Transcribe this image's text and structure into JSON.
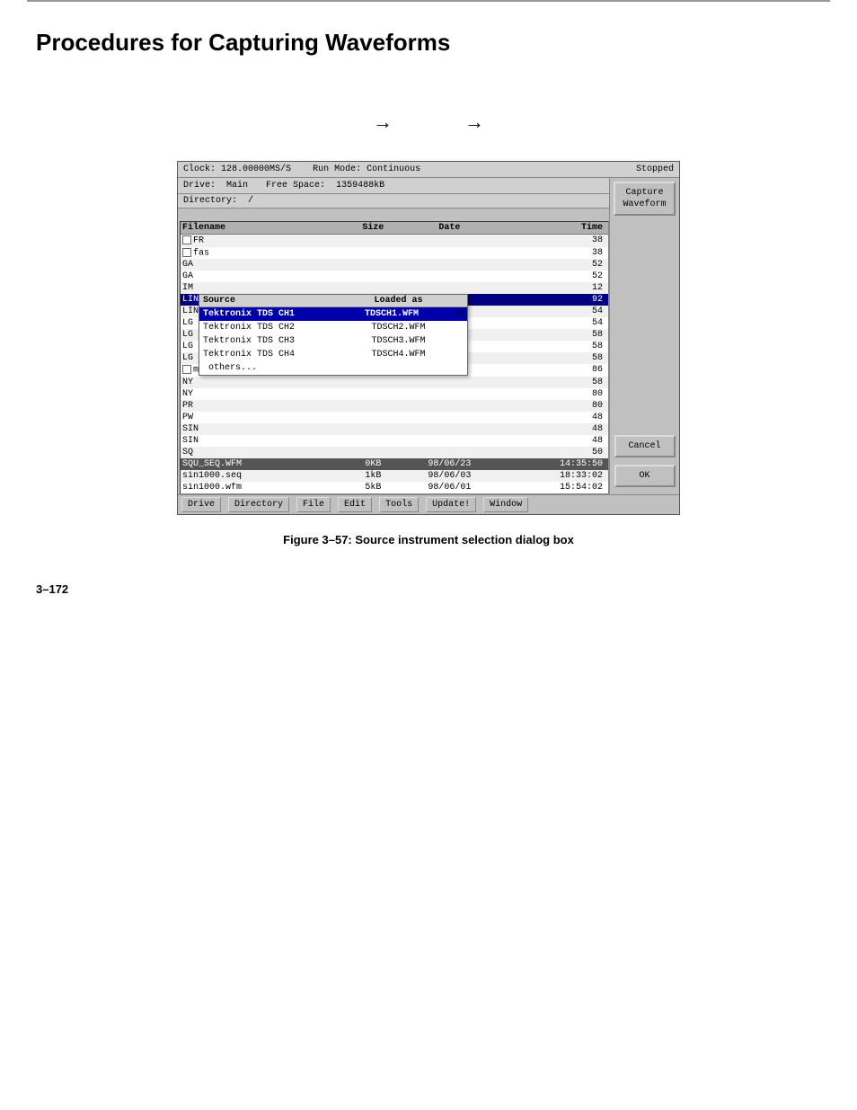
{
  "page": {
    "title": "Procedures for Capturing Waveforms",
    "page_number": "3–172"
  },
  "arrows": {
    "arrow1": "→",
    "arrow2": "→"
  },
  "dialog": {
    "topbar": {
      "clock_label": "Clock:",
      "clock_value": "128.00000MS/S",
      "runmode_label": "Run Mode:",
      "runmode_value": "Continuous",
      "status": "Stopped"
    },
    "header": {
      "drive_label": "Drive:",
      "drive_value": "Main",
      "freespace_label": "Free Space:",
      "freespace_value": "1359488kB"
    },
    "capture_btn": "Capture\nWaveform",
    "directory_label": "Directory:",
    "directory_value": "/",
    "table_headers": {
      "filename": "Filename",
      "size": "Size",
      "date": "Date",
      "time": "Time"
    },
    "files": [
      {
        "name": "FR",
        "checkbox": true,
        "size": "",
        "date": "",
        "time": "38"
      },
      {
        "name": "fas",
        "checkbox": true,
        "size": "",
        "date": "",
        "time": "38"
      },
      {
        "name": "GA",
        "checkbox": false,
        "size": "",
        "date": "",
        "time": "52"
      },
      {
        "name": "GA",
        "checkbox": false,
        "size": "",
        "date": "",
        "time": "52"
      },
      {
        "name": "IM",
        "checkbox": false,
        "size": "",
        "date": "",
        "time": "12"
      },
      {
        "name": "LIN",
        "checkbox": false,
        "size": "",
        "date": "",
        "time": "92",
        "selected": true
      },
      {
        "name": "LIN",
        "checkbox": false,
        "size": "",
        "date": "",
        "time": "54"
      },
      {
        "name": "LG",
        "checkbox": false,
        "size": "",
        "date": "",
        "time": "54"
      },
      {
        "name": "LG",
        "checkbox": false,
        "size": "",
        "date": "",
        "time": "58"
      },
      {
        "name": "LG",
        "checkbox": false,
        "size": "",
        "date": "",
        "time": "58"
      },
      {
        "name": "LG",
        "checkbox": false,
        "size": "",
        "date": "",
        "time": "58"
      },
      {
        "name": "me",
        "checkbox": true,
        "size": "",
        "date": "",
        "time": "86"
      },
      {
        "name": "NY",
        "checkbox": false,
        "size": "",
        "date": "",
        "time": "58"
      },
      {
        "name": "NY",
        "checkbox": false,
        "size": "",
        "date": "",
        "time": "80"
      },
      {
        "name": "PR",
        "checkbox": false,
        "size": "",
        "date": "",
        "time": "80"
      },
      {
        "name": "PW",
        "checkbox": false,
        "size": "",
        "date": "",
        "time": "48"
      },
      {
        "name": "SIN",
        "checkbox": false,
        "size": "",
        "date": "",
        "time": "48"
      },
      {
        "name": "SIN",
        "checkbox": false,
        "size": "",
        "date": "",
        "time": "48"
      },
      {
        "name": "SQ",
        "checkbox": false,
        "size": "",
        "date": "",
        "time": "50"
      },
      {
        "name": "SQU_SEQ.WFM",
        "checkbox": false,
        "size": "0KB",
        "date": "98/06/23",
        "time": "14:35:50",
        "bottom": true
      },
      {
        "name": "sin1000.seq",
        "checkbox": false,
        "size": "1kB",
        "date": "98/06/03",
        "time": "18:33:02"
      },
      {
        "name": "sin1000.wfm",
        "checkbox": false,
        "size": "5kB",
        "date": "98/06/01",
        "time": "15:54:02"
      }
    ],
    "source_dropdown": {
      "header_source": "Source",
      "header_loaded": "Loaded as",
      "items": [
        {
          "source": "Tektronix TDS CH1",
          "loaded": "TDSCH1.WFM",
          "bold": true
        },
        {
          "source": "Tektronix TDS CH2",
          "loaded": "TDSCH2.WFM",
          "bold": false
        },
        {
          "source": "Tektronix TDS CH3",
          "loaded": "TDSCH3.WFM",
          "bold": false
        },
        {
          "source": "Tektronix TDS CH4",
          "loaded": "TDSCH4.WFM",
          "bold": false
        },
        {
          "source": "others...",
          "loaded": "",
          "bold": false
        }
      ]
    },
    "side_buttons": {
      "cancel": "Cancel",
      "ok": "OK"
    },
    "menubar_items": [
      "Drive",
      "Directory",
      "File",
      "Edit",
      "Tools",
      "Update!",
      "Window"
    ]
  },
  "figure_caption": "Figure 3–57: Source instrument selection dialog box"
}
